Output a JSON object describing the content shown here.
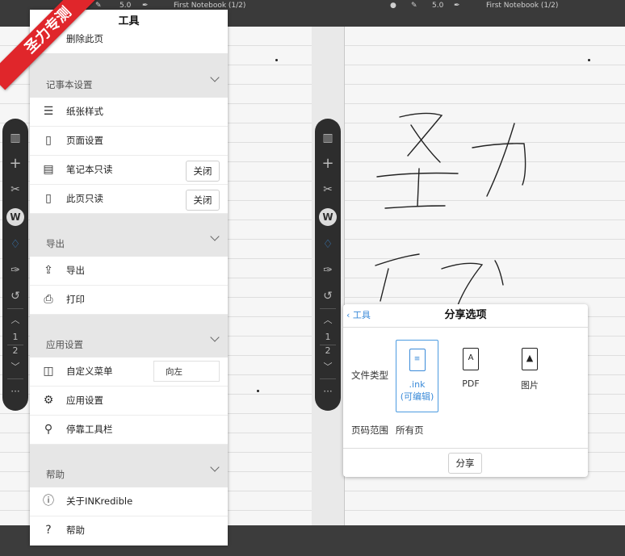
{
  "left_topbar": {
    "pen_size": "5.0",
    "title": "First Notebook (1/2)"
  },
  "right_topbar": {
    "pen_size": "5.0",
    "title": "First Notebook (1/2)"
  },
  "toolbar": {
    "badge": "W",
    "page_current": "1",
    "page_total": "2",
    "more": "···"
  },
  "ribbon": {
    "text": "圣力专测"
  },
  "menu": {
    "title": "工具",
    "delete_page": "删除此页",
    "sections": {
      "notebook": "记事本设置",
      "export": "导出",
      "app": "应用设置",
      "help": "帮助"
    },
    "items": {
      "paper_style": "纸张样式",
      "page_setup": "页面设置",
      "notebook_readonly": "笔记本只读",
      "page_readonly": "此页只读",
      "export": "导出",
      "print": "打印",
      "custom_menu": "自定义菜单",
      "app_settings": "应用设置",
      "dock_toolbar": "停靠工具栏",
      "about": "关于INKredible",
      "help": "帮助"
    },
    "toggle_off": "关闭",
    "custom_menu_value": "向左"
  },
  "share": {
    "back": "工具",
    "title": "分享选项",
    "file_type_label": "文件类型",
    "options": {
      "ink": ".ink",
      "ink_sub": "(可编辑)",
      "pdf": "PDF",
      "image": "图片"
    },
    "page_range_label": "页码范围",
    "page_range_value": "所有页",
    "share_button": "分享"
  },
  "colors": {
    "accent": "#3a8ad8",
    "ribbon": "#e0262b",
    "toolbar": "#2d2d2d"
  }
}
